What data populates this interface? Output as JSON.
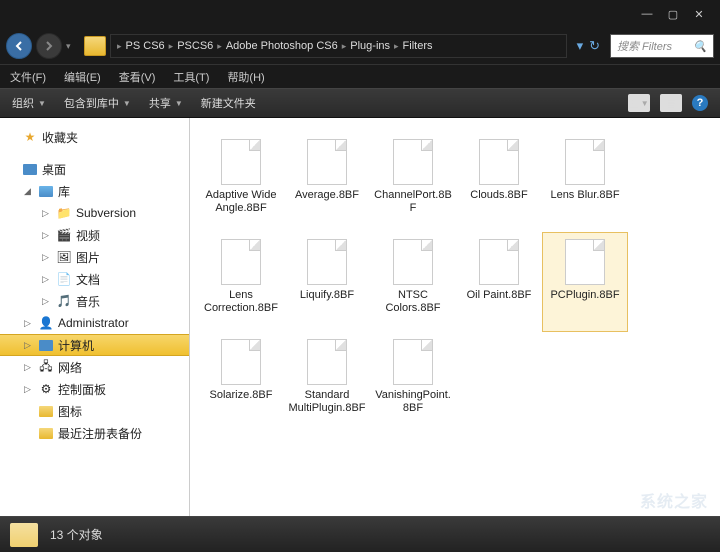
{
  "titlebar": {
    "min": "—",
    "max": "▢",
    "close": "✕"
  },
  "breadcrumb": [
    "PS CS6",
    "PSCS6",
    "Adobe Photoshop CS6",
    "Plug-ins",
    "Filters"
  ],
  "search": {
    "placeholder": "搜索 Filters"
  },
  "menu": [
    "文件(F)",
    "编辑(E)",
    "查看(V)",
    "工具(T)",
    "帮助(H)"
  ],
  "toolbar": {
    "org": "组织",
    "lib": "包含到库中",
    "share": "共享",
    "newfolder": "新建文件夹"
  },
  "tree": {
    "favorites": "收藏夹",
    "desktop": "桌面",
    "library": "库",
    "items": [
      "Subversion",
      "视频",
      "图片",
      "文档",
      "音乐"
    ],
    "admin": "Administrator",
    "computer": "计算机",
    "network": "网络",
    "cpanel": "控制面板",
    "icons": "图标",
    "recent": "最近注册表备份"
  },
  "files": [
    {
      "name": "Adaptive Wide Angle.8BF",
      "hl": false
    },
    {
      "name": "Average.8BF",
      "hl": false
    },
    {
      "name": "ChannelPort.8BF",
      "hl": false
    },
    {
      "name": "Clouds.8BF",
      "hl": false
    },
    {
      "name": "Lens Blur.8BF",
      "hl": false
    },
    {
      "name": "Lens Correction.8BF",
      "hl": false
    },
    {
      "name": "Liquify.8BF",
      "hl": false
    },
    {
      "name": "NTSC Colors.8BF",
      "hl": false
    },
    {
      "name": "Oil Paint.8BF",
      "hl": false
    },
    {
      "name": "PCPlugin.8BF",
      "hl": true
    },
    {
      "name": "Solarize.8BF",
      "hl": false
    },
    {
      "name": "Standard MultiPlugin.8BF",
      "hl": false
    },
    {
      "name": "VanishingPoint.8BF",
      "hl": false
    }
  ],
  "status": {
    "count": "13 个对象"
  },
  "watermark": "系统之家"
}
